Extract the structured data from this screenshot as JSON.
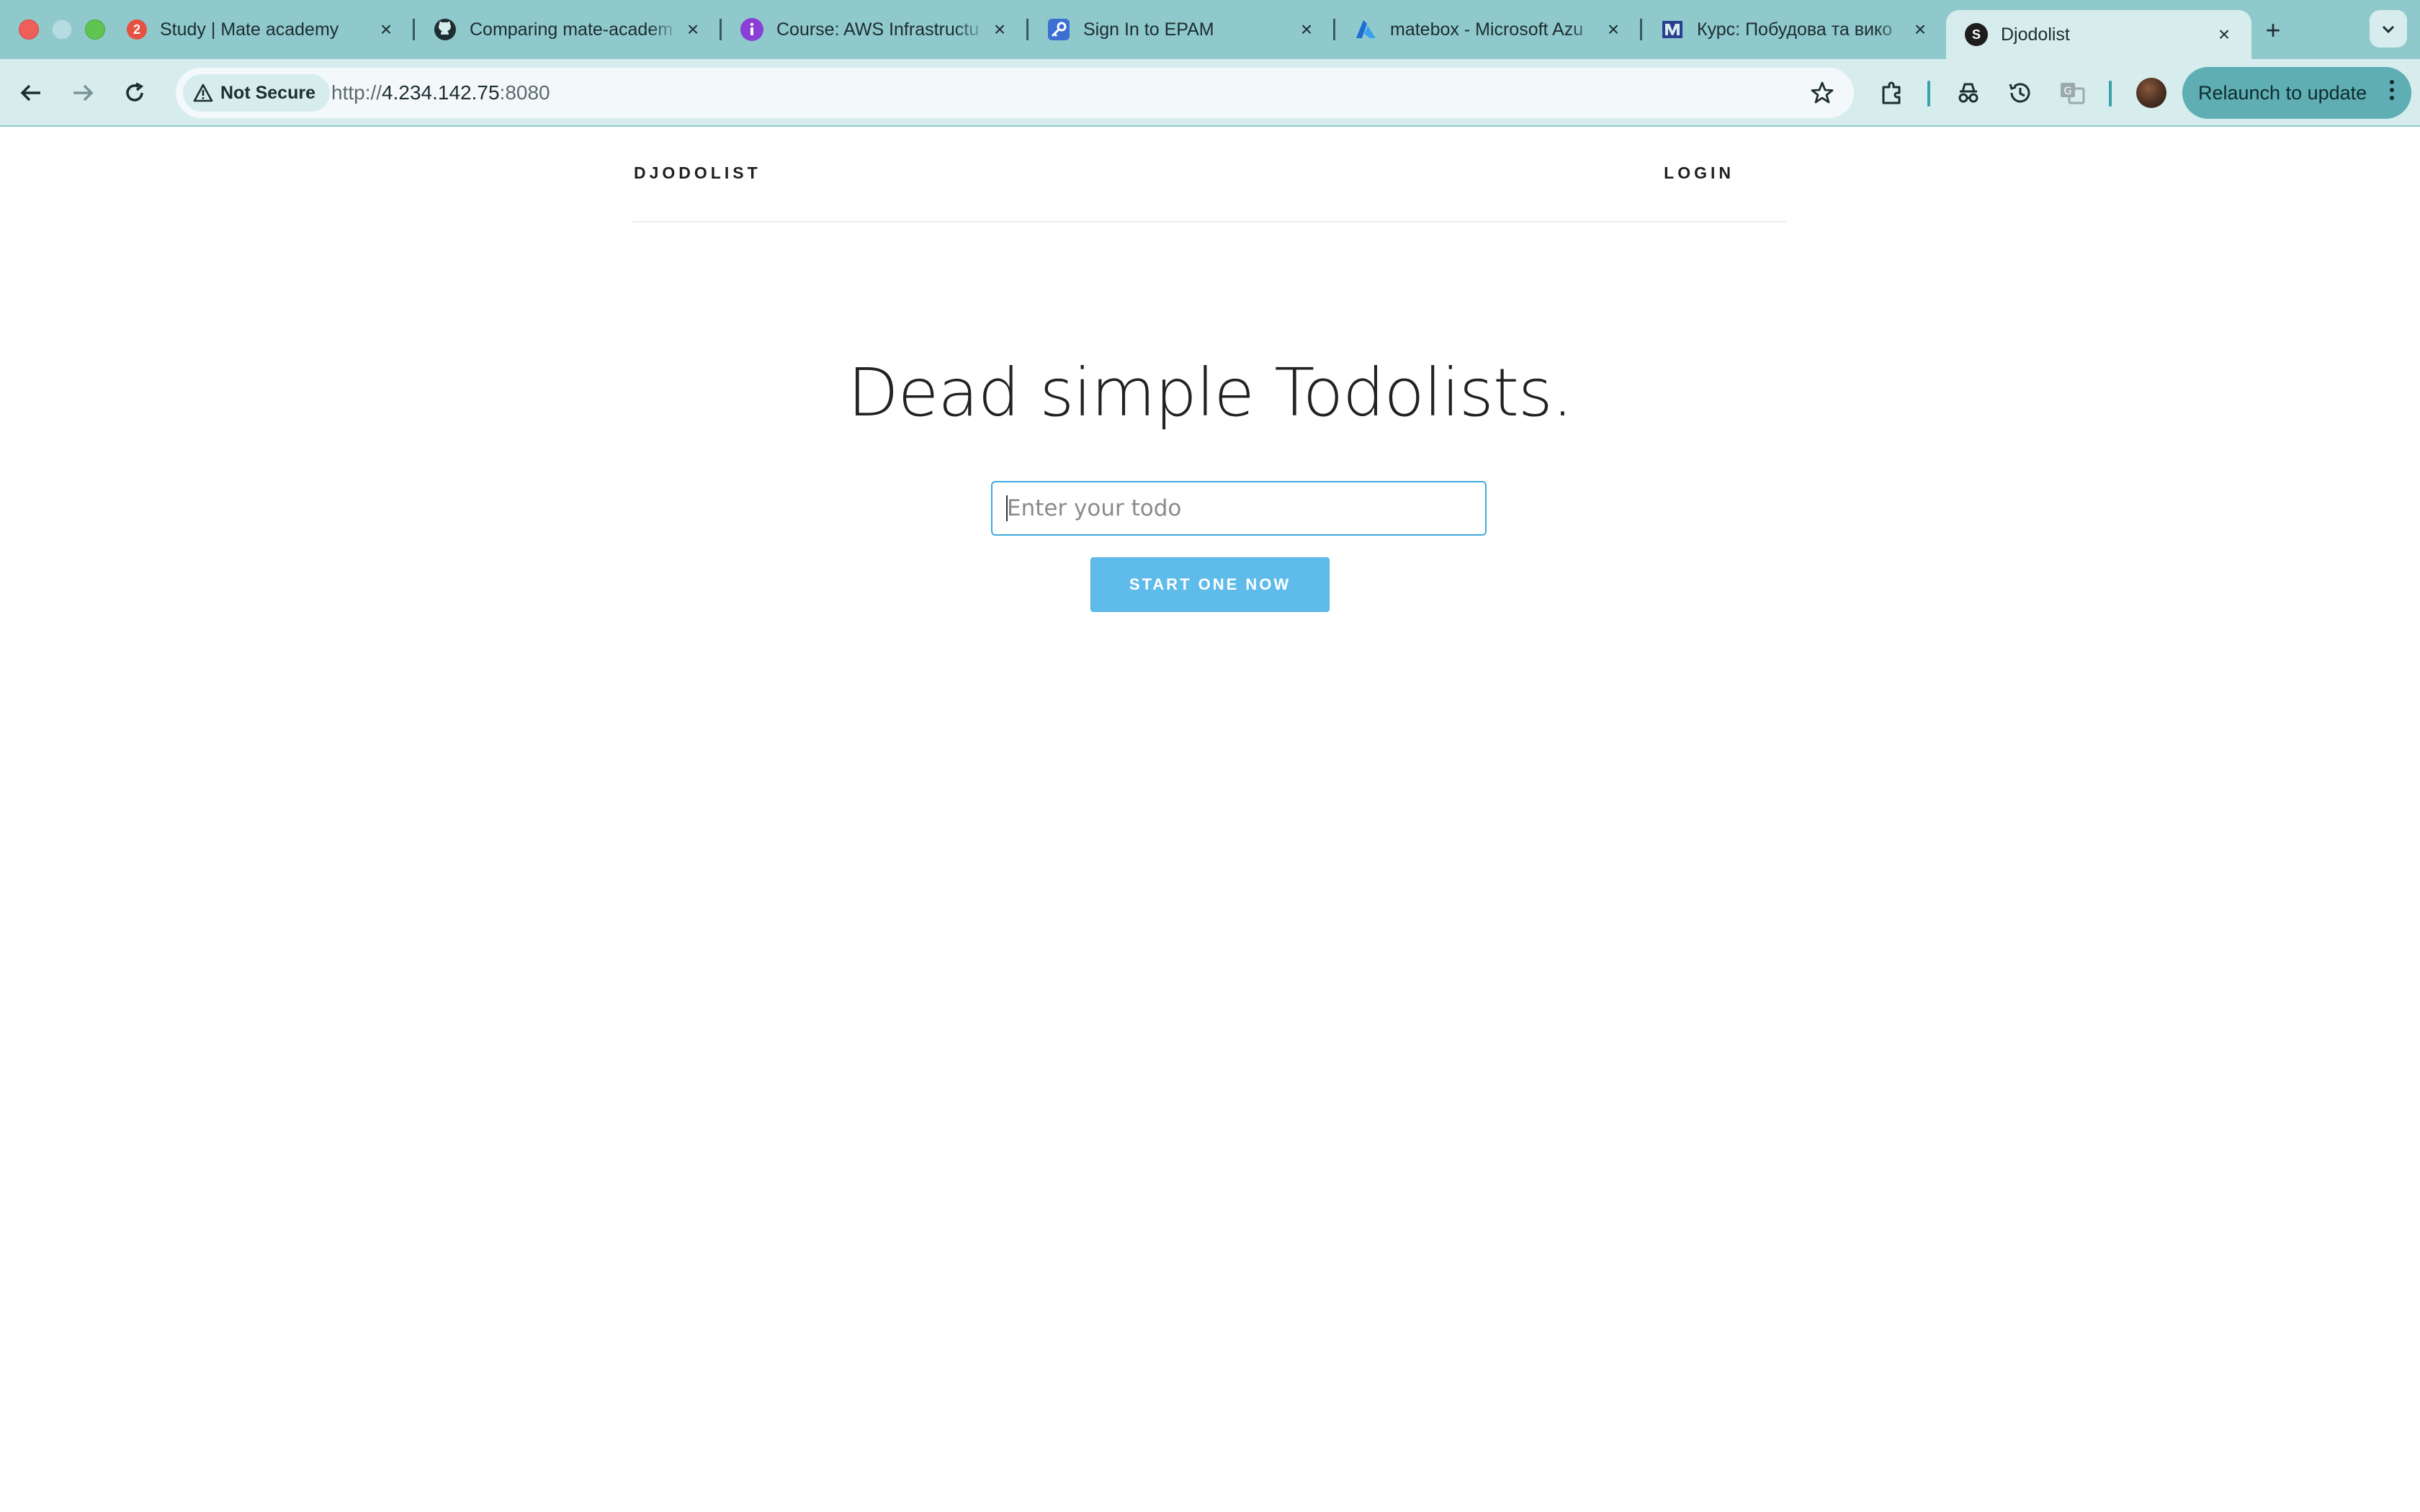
{
  "browser": {
    "tabs": [
      {
        "title": "Study | Mate academy",
        "badge": "2",
        "favicon": "mate-academy-badge-icon",
        "color": "#e5523f"
      },
      {
        "title": "Comparing mate-academ",
        "favicon": "github-icon",
        "color": "#1d2d30"
      },
      {
        "title": "Course: AWS Infrastructu",
        "favicon": "course-info-icon",
        "color": "#8a3fd6"
      },
      {
        "title": "Sign In to EPAM",
        "favicon": "key-icon",
        "color": "#3b6fd1"
      },
      {
        "title": "matebox - Microsoft Azu",
        "favicon": "azure-icon",
        "color": "#1f6fd1"
      },
      {
        "title": "Курс: Побудова та вико",
        "favicon": "course-logo-icon",
        "color": "#2a3f8f"
      },
      {
        "title": "Djodolist",
        "favicon": "s-icon",
        "color": "#1d1d1d",
        "fav_letter": "S"
      }
    ],
    "security_label": "Not Secure",
    "url_scheme": "http://",
    "url_host": "4.234.142.75",
    "url_port": ":8080",
    "relaunch_label": "Relaunch to update"
  },
  "site": {
    "brand": "DJODOLIST",
    "login": "LOGIN",
    "headline": "Dead simple Todolists.",
    "input_placeholder": "Enter your todo",
    "start_button": "START ONE NOW"
  },
  "colors": {
    "tabstrip": "#8fc9cc",
    "toolbar": "#d6eced",
    "input_border": "#41a9e0",
    "button": "#5ebbea"
  }
}
